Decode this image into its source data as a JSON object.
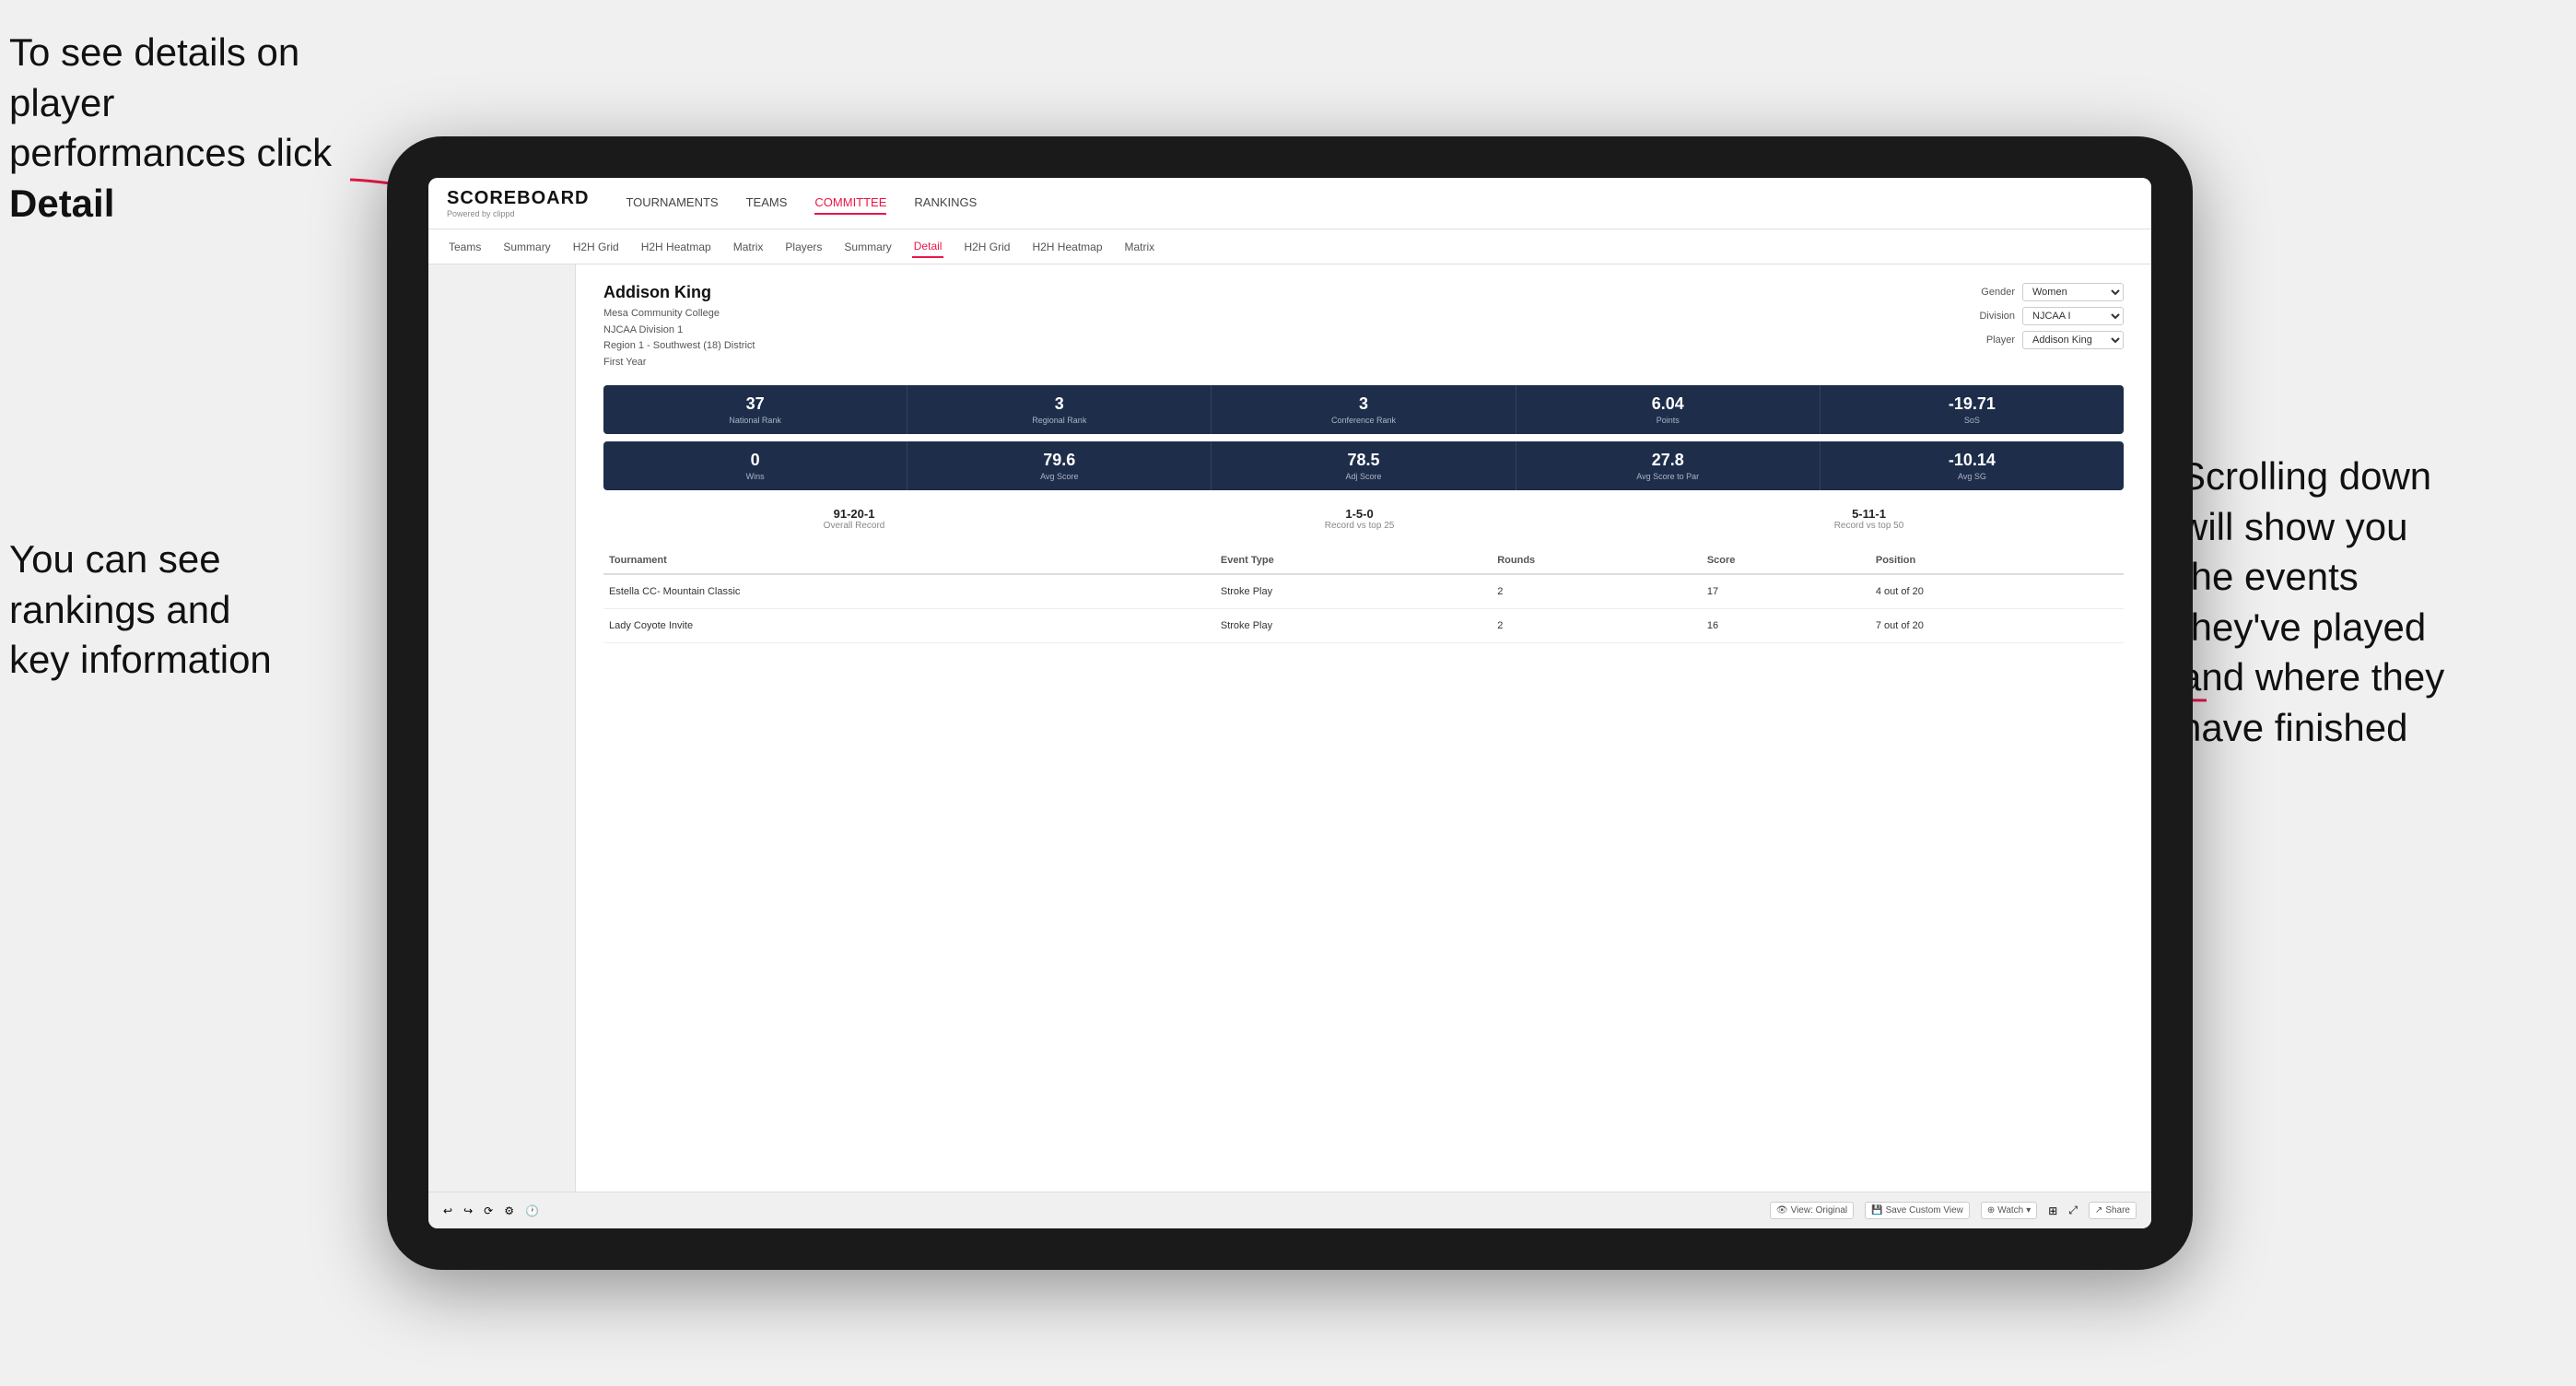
{
  "annotations": {
    "top_left": "To see details on player performances click ",
    "top_left_bold": "Detail",
    "bottom_left_line1": "You can see",
    "bottom_left_line2": "rankings and",
    "bottom_left_line3": "key information",
    "right_line1": "Scrolling down",
    "right_line2": "will show you",
    "right_line3": "the events",
    "right_line4": "they've played",
    "right_line5": "and where they",
    "right_line6": "have finished"
  },
  "app": {
    "logo_main": "SCOREBOARD",
    "logo_sub": "Powered by clippd",
    "nav_items": [
      "TOURNAMENTS",
      "TEAMS",
      "COMMITTEE",
      "RANKINGS"
    ],
    "active_nav": "COMMITTEE"
  },
  "sub_nav": {
    "items": [
      "Teams",
      "Summary",
      "H2H Grid",
      "H2H Heatmap",
      "Matrix",
      "Players",
      "Summary",
      "Detail",
      "H2H Grid",
      "H2H Heatmap",
      "Matrix"
    ],
    "active_item": "Detail"
  },
  "player": {
    "name": "Addison King",
    "school": "Mesa Community College",
    "division": "NJCAA Division 1",
    "region": "Region 1 - Southwest (18) District",
    "year": "First Year"
  },
  "filters": {
    "gender_label": "Gender",
    "gender_value": "Women",
    "division_label": "Division",
    "division_value": "NJCAA I",
    "player_label": "Player",
    "player_value": "Addison King"
  },
  "stats_row1": [
    {
      "value": "37",
      "label": "National Rank"
    },
    {
      "value": "3",
      "label": "Regional Rank"
    },
    {
      "value": "3",
      "label": "Conference Rank"
    },
    {
      "value": "6.04",
      "label": "Points"
    },
    {
      "value": "-19.71",
      "label": "SoS"
    }
  ],
  "stats_row2": [
    {
      "value": "0",
      "label": "Wins"
    },
    {
      "value": "79.6",
      "label": "Avg Score"
    },
    {
      "value": "78.5",
      "label": "Adj Score"
    },
    {
      "value": "27.8",
      "label": "Avg Score to Par"
    },
    {
      "value": "-10.14",
      "label": "Avg SG"
    }
  ],
  "records": [
    {
      "value": "91-20-1",
      "label": "Overall Record"
    },
    {
      "value": "1-5-0",
      "label": "Record vs top 25"
    },
    {
      "value": "5-11-1",
      "label": "Record vs top 50"
    }
  ],
  "table": {
    "headers": [
      "Tournament",
      "Event Type",
      "Rounds",
      "Score",
      "Position"
    ],
    "rows": [
      {
        "tournament": "Estella CC- Mountain Classic",
        "event_type": "Stroke Play",
        "rounds": "2",
        "score": "17",
        "position": "4 out of 20"
      },
      {
        "tournament": "Lady Coyote Invite",
        "event_type": "Stroke Play",
        "rounds": "2",
        "score": "16",
        "position": "7 out of 20"
      }
    ]
  },
  "toolbar": {
    "buttons": [
      "View: Original",
      "Save Custom View",
      "Watch",
      "Share"
    ]
  }
}
